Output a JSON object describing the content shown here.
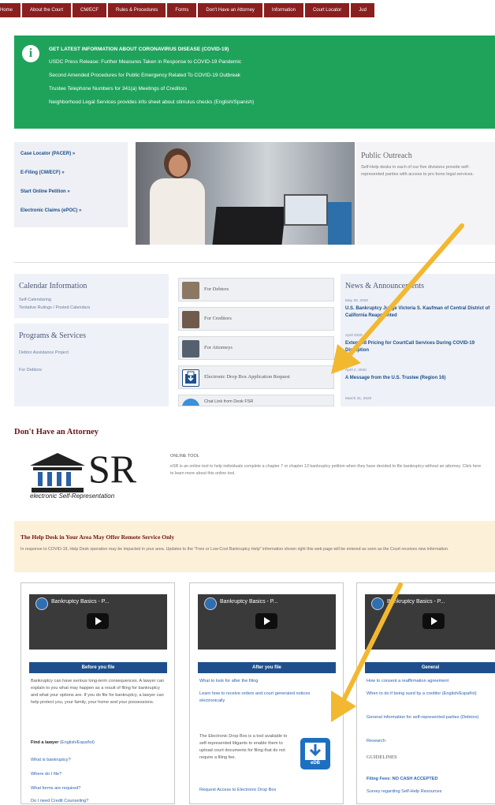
{
  "nav": {
    "items": [
      "Home",
      "About the Court",
      "CM/ECF",
      "Rules & Procedures",
      "Forms",
      "Don't Have an Attorney",
      "Information",
      "Court Locator",
      "Jud"
    ]
  },
  "alert": {
    "title": "GET LATEST INFORMATION ABOUT CORONAVIRUS DISEASE (COVID-19)",
    "lines": [
      "USDC Press Release: Further Measures Taken in Response to COVID-19 Pandemic",
      "Second Amended Procedures for Public Emergency Related To COVID-19 Outbreak",
      "Trustee Telephone Numbers for 341(a) Meetings of Creditors",
      "Neighborhood Legal Services provides info sheet about stimulus checks (English/Spanish)"
    ]
  },
  "quick_links": [
    "Case Locator (PACER) »",
    "E-Filing (CM/ECF) »",
    "Start Online Petition »",
    "Electronic Claims (ePOC) »"
  ],
  "outreach": {
    "title": "Public Outreach",
    "text": "Self-Help desks in each of our five divisions provide self-represented parties with access to pro bono legal services."
  },
  "calendar": {
    "title": "Calendar Information",
    "links": [
      "Self-Calendaring",
      "Tentative Rulings / Posted Calendars"
    ]
  },
  "programs": {
    "title": "Programs & Services",
    "links": [
      "Debtor Assistance Project",
      "For Debtors"
    ]
  },
  "middle_buttons": [
    "For Debtors",
    "For Creditors",
    "For Attorneys",
    "Electronic Drop Box Application Request",
    "Chat Link from Desk FSR"
  ],
  "news": {
    "title": "News & Announcements",
    "items": [
      {
        "date": "May 26, 2020",
        "text": "U.S. Bankruptcy Judge Victoria S. Kaufman of Central District of California Reappointed"
      },
      {
        "date": "April 2020",
        "text": "Extended Pricing for CourtCall Services During COVID-19 Disruption"
      },
      {
        "date": "April 2, 2020",
        "text": "A Message from the U.S. Trustee (Region 16)"
      },
      {
        "date": "March 31, 2020",
        "text": ""
      }
    ]
  },
  "dha": {
    "title": "Don't Have an Attorney",
    "logo_letters": "SR",
    "logo_caption": "electronic Self-Representation",
    "tool_label": "ONLINE TOOL",
    "tool_text": "eSR is an online tool to help individuals complete a chapter 7 or chapter 13 bankruptcy petition when they have decided to file bankruptcy without an attorney. Click here to learn more about this online tool."
  },
  "help_desk": {
    "title": "The Help Desk in Your Area May Offer Remote Service Only",
    "text": "In response to COVID-19, Help Desk operation may be impacted in your area. Updates to the \"Free or Low-Cost Bankruptcy Help\" information shown right this web page will be entered as soon as the Court receives new information."
  },
  "cards": [
    {
      "video_title": "Bankruptcy Basics - P...",
      "bar": "Before you file",
      "text": "Bankruptcy can have serious long-term consequences. A lawyer can explain to you what may happen as a result of filing for bankruptcy and what your options are. If you do file for bankruptcy, a lawyer can help protect you, your family, your home and your possessions.",
      "bold": "Find a lawyer",
      "bold_suffix": "(English/Español)",
      "links": [
        "What is bankruptcy?",
        "Where do I file?",
        "What forms are required?",
        "Do I need Credit Counseling?"
      ]
    },
    {
      "video_title": "Bankruptcy Basics - P...",
      "bar": "After you file",
      "links": [
        "What to look for after the filing",
        "Learn how to receive orders and court generated notices electronically"
      ],
      "text": "The Electronic Drop Box is a tool available to self-represented litigants to enable them to upload court documents for filing that do not require a filing fee.",
      "extra_link": "Request Access to Electronic Drop Box",
      "icon_label": "eDB"
    },
    {
      "video_title": "Bankruptcy Basics - P...",
      "bar": "General",
      "links": [
        "How to consent a reaffirmation agreement",
        "When to do if being sued by a creditor (English/Español)",
        "General information for self-represented parties (Debtors)",
        "Research"
      ],
      "subhead": "GUIDELINES",
      "links2": [
        "Filing Fees: NO CASH ACCEPTED",
        "Survey regarding Self-Help Resources"
      ]
    }
  ],
  "colors": {
    "nav": "#8a1f1f",
    "alert": "#1fa35b",
    "accent_blue": "#1e4f8c",
    "arrow": "#f2b830"
  }
}
